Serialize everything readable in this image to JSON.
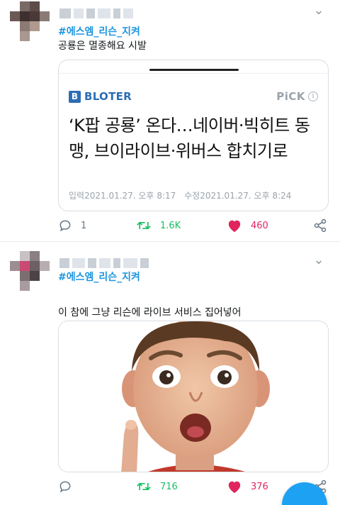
{
  "colors": {
    "link": "#1b95e0",
    "retweet": "#17bf63",
    "like": "#e0245e",
    "muted": "#657786",
    "brand": "#2c6db6"
  },
  "tweets": [
    {
      "hashtag": "#에스엠_리슨_지켜",
      "text": "공룡은 멸종해요 시발",
      "card": {
        "brand_mark": "B",
        "brand_name": "BLOTER",
        "pick_label": "PiCK",
        "info_icon": "i",
        "headline": "‘K팝 공룡’ 온다…네이버·빅히트 동맹, 브이라이브·위버스 합치기로",
        "published_label": "입력",
        "published_value": "2021.01.27. 오후 8:17",
        "modified_label": "수정",
        "modified_value": "2021.01.27. 오후 8:24"
      },
      "actions": {
        "replies": "1",
        "retweets": "1.6K",
        "likes": "460"
      }
    },
    {
      "hashtag": "#에스엠_리슨_지켜",
      "text": "이 참에 그냥 리슨에 라이브 서비스 집어넣어",
      "actions": {
        "replies": "",
        "retweets": "716",
        "likes": "376"
      }
    }
  ],
  "icons": {
    "menu": "chevron-down-icon",
    "reply": "reply-icon",
    "retweet": "retweet-icon",
    "like": "heart-icon",
    "share": "share-icon"
  }
}
